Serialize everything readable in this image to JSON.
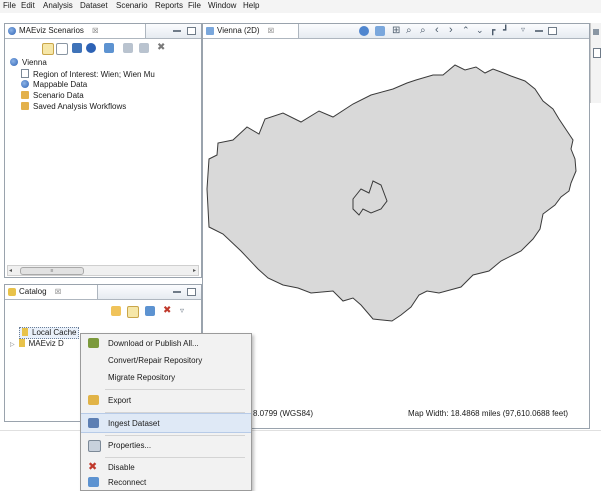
{
  "menubar": {
    "items": [
      "File",
      "Edit",
      "Analysis",
      "Dataset",
      "Scenario",
      "Reports",
      "File",
      "Window",
      "Help"
    ]
  },
  "scenarios_panel": {
    "tab_label": "MAEviz Scenarios",
    "close_glyph": "☒",
    "tree": {
      "root": "Vienna",
      "children": [
        "Region of Interest: Wien; Wien Mu",
        "Mappable Data",
        "Scenario Data",
        "Saved Analysis Workflows"
      ]
    },
    "scrollbar_thumb_label": "≡"
  },
  "map_panel": {
    "tab_label": "Vienna (2D)",
    "close_glyph": "☒",
    "status_coords": "8.0799 (WGS84)",
    "status_width": "Map Width: 18.4868 miles (97,610.0688 feet)"
  },
  "catalog_panel": {
    "tab_label": "Catalog",
    "close_glyph": "☒",
    "tree": [
      "Local Cache",
      "MAEviz D"
    ]
  },
  "context_menu": {
    "items": [
      {
        "label": "Download or Publish All...",
        "icon": "download-icon"
      },
      {
        "label": "Convert/Repair Repository",
        "icon": ""
      },
      {
        "label": "Migrate Repository",
        "icon": ""
      },
      {
        "label": "Export",
        "icon": "export-icon"
      },
      {
        "label": "Ingest Dataset",
        "icon": "ingest-icon"
      },
      {
        "label": "Properties...",
        "icon": "properties-icon"
      },
      {
        "label": "Disable",
        "icon": "disable-icon"
      },
      {
        "label": "Reconnect",
        "icon": "reconnect-icon"
      }
    ],
    "selected": "Ingest Dataset"
  },
  "colors": {
    "map_fill": "#d9d9d9",
    "map_stroke": "#3a3a3a",
    "menu_highlight": "#dfe9f6",
    "panel_border": "#9aa3ad"
  }
}
